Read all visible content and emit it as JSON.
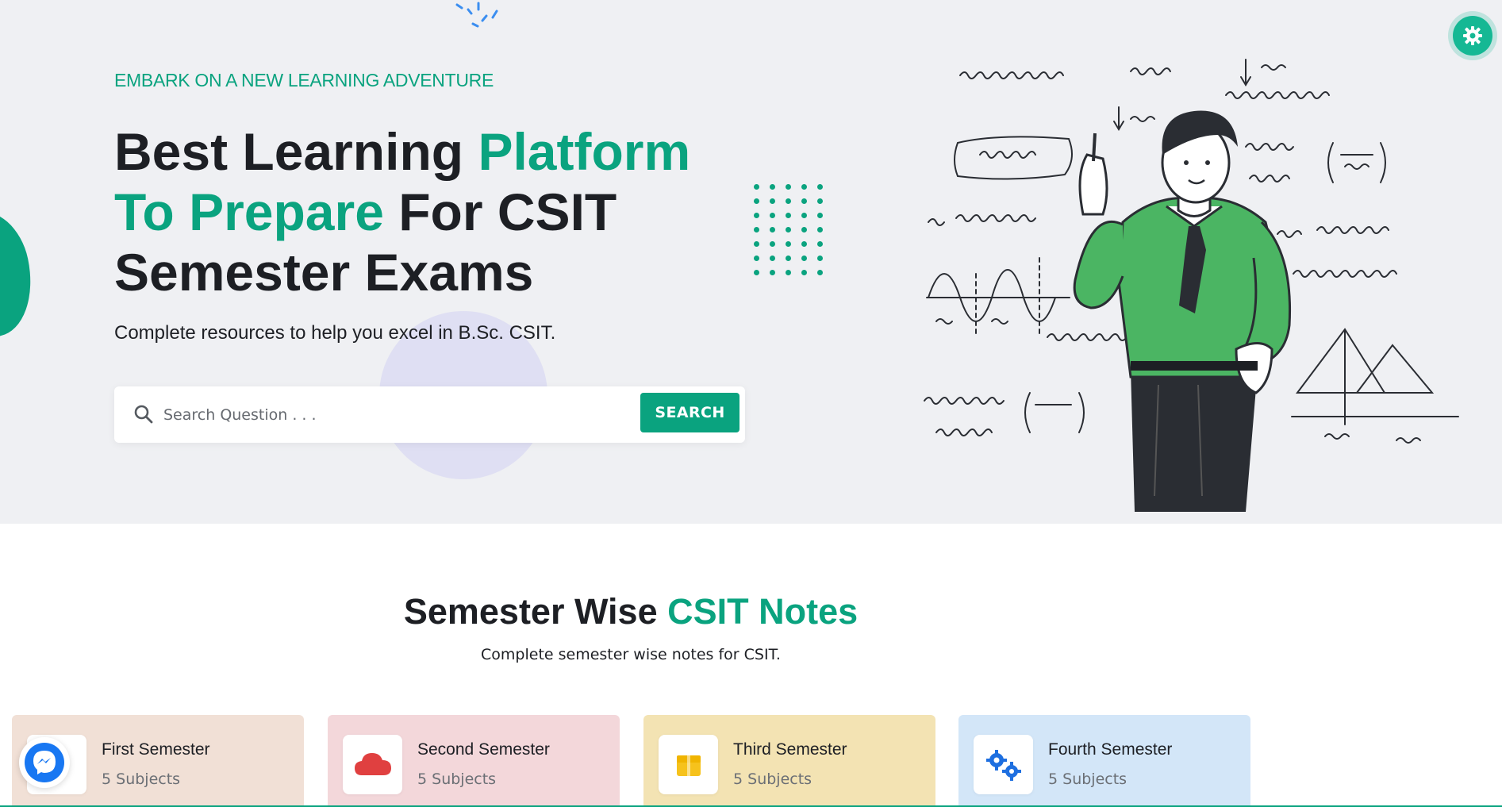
{
  "hero": {
    "eyebrow": "EMBARK ON A NEW LEARNING ADVENTURE",
    "headline": {
      "part1": "Best Learning ",
      "part2": "Platform To Prepare",
      "part3": " For CSIT Semester Exams"
    },
    "lead": "Complete resources to help you excel in B.Sc. CSIT.",
    "search": {
      "placeholder": "Search Question . . .",
      "value": "",
      "button_label": "SEARCH"
    }
  },
  "section": {
    "title_part1": "Semester Wise ",
    "title_part2": "CSIT Notes",
    "subtitle": "Complete semester wise notes for CSIT."
  },
  "semesters": [
    {
      "title": "First Semester",
      "count": "5 Subjects",
      "bg": "#f1e0d6",
      "icon": "book-icon"
    },
    {
      "title": "Second Semester",
      "count": "5 Subjects",
      "bg": "#f3d7da",
      "icon": "cloud-icon"
    },
    {
      "title": "Third Semester",
      "count": "5 Subjects",
      "bg": "#f3e3b3",
      "icon": "box-icon"
    },
    {
      "title": "Fourth Semester",
      "count": "5 Subjects",
      "bg": "#d3e6f8",
      "icon": "gears-icon"
    }
  ],
  "colors": {
    "accent": "#0aa37f",
    "hero_bg": "#eff0f3",
    "text_dark": "#1d1f24"
  },
  "icons": {
    "settings": "gear-icon",
    "search": "search-icon",
    "chat": "messenger-icon"
  }
}
